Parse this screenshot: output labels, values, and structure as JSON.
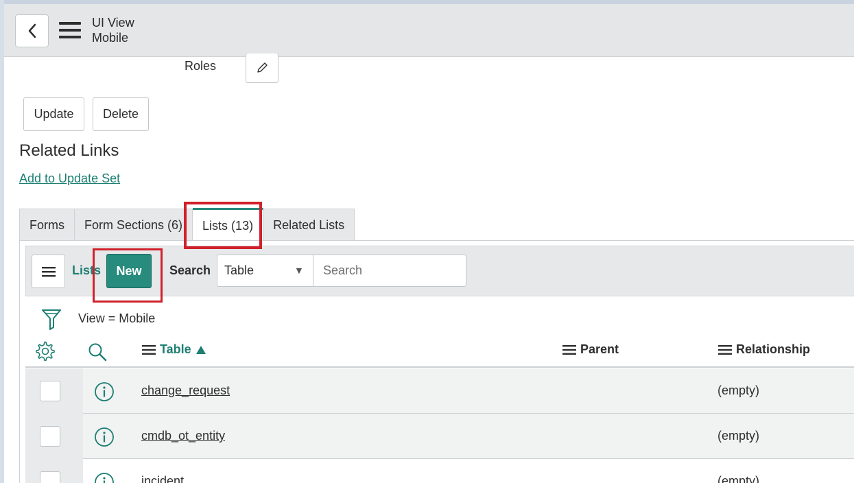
{
  "header": {
    "title": "UI View",
    "subtitle": "Mobile"
  },
  "form": {
    "roles_label": "Roles"
  },
  "actions": {
    "update_label": "Update",
    "delete_label": "Delete"
  },
  "related_links": {
    "heading": "Related Links",
    "add_to_update_set": "Add to Update Set"
  },
  "tabs": [
    {
      "label": "Forms"
    },
    {
      "label": "Form Sections (6)"
    },
    {
      "label": "Lists (13)",
      "active": true
    },
    {
      "label": "Related Lists"
    }
  ],
  "list_toolbar": {
    "title": "Lists",
    "new_label": "New",
    "search_label": "Search",
    "field_selected": "Table",
    "search_placeholder": "Search"
  },
  "filter": {
    "text": "View = Mobile"
  },
  "columns": {
    "table": "Table",
    "parent": "Parent",
    "relationship": "Relationship"
  },
  "rows": [
    {
      "table": "change_request",
      "parent": "",
      "relationship": "(empty)"
    },
    {
      "table": "cmdb_ot_entity",
      "parent": "",
      "relationship": "(empty)"
    },
    {
      "table": "incident",
      "parent": "",
      "relationship": "(empty)"
    }
  ],
  "colors": {
    "accent": "#278b7d",
    "link": "#1d7f73",
    "highlight": "#d0202b"
  }
}
